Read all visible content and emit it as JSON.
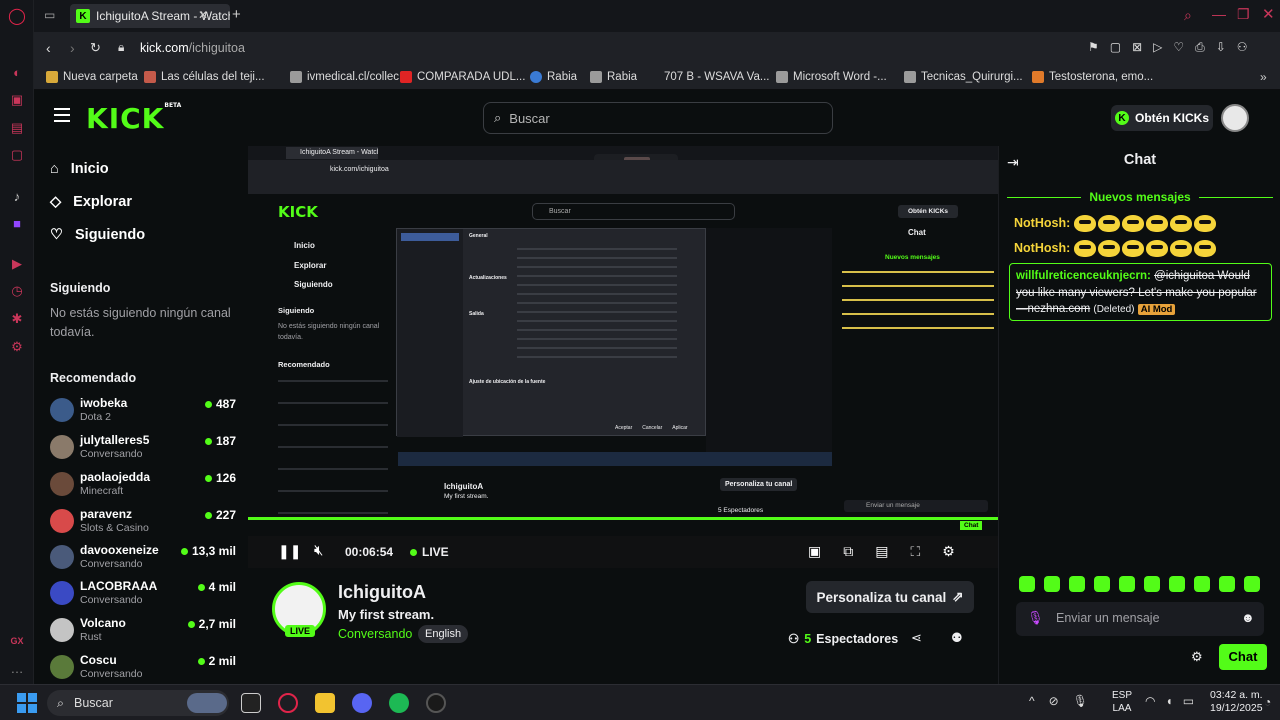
{
  "browser": {
    "tab_title": "IchiguitoA Stream - Watch",
    "new_tab": "+",
    "url_host": "kick.com",
    "url_path": "/ichiguitoa",
    "bookmarks": [
      {
        "label": "Nueva carpeta",
        "color": "#d8a93a"
      },
      {
        "label": "Las células del teji...",
        "color": "#c45a4a"
      },
      {
        "label": "ivmedical.cl/collec...",
        "color": "#9b9b9b"
      },
      {
        "label": "COMPARADA UDL...",
        "color": "#e02424"
      },
      {
        "label": "Rabia",
        "color": "#3a7bd5"
      },
      {
        "label": "Rabia",
        "color": "#9b9b9b"
      },
      {
        "label": "707 B - WSAVA Va...",
        "color": "#1c1e22"
      },
      {
        "label": "Microsoft Word -...",
        "color": "#9b9b9b"
      },
      {
        "label": "Tecnicas_Quirurgi...",
        "color": "#9b9b9b"
      },
      {
        "label": "Testosterona, emo...",
        "color": "#e07a2a"
      }
    ]
  },
  "header": {
    "logo": "KICK",
    "logo_sup": "BETA",
    "search_placeholder": "Buscar",
    "kicks_button": "Obtén KICKs"
  },
  "sidebar": {
    "nav": [
      {
        "label": "Inicio",
        "icon": "home-icon"
      },
      {
        "label": "Explorar",
        "icon": "compass-icon"
      },
      {
        "label": "Siguiendo",
        "icon": "heart-icon"
      }
    ],
    "following_title": "Siguiendo",
    "following_empty": "No estás siguiendo ningún canal todavía.",
    "recommended_title": "Recomendado",
    "recommended": [
      {
        "name": "iwobeka",
        "category": "Dota 2",
        "viewers": "487",
        "color": "#3b5b8a"
      },
      {
        "name": "julytalleres5",
        "category": "Conversando",
        "viewers": "187",
        "color": "#8a7a6a"
      },
      {
        "name": "paolaojedda",
        "category": "Minecraft",
        "viewers": "126",
        "color": "#6a4a3a"
      },
      {
        "name": "paravenz",
        "category": "Slots & Casino",
        "viewers": "227",
        "color": "#d84a4a"
      },
      {
        "name": "davooxeneize",
        "category": "Conversando",
        "viewers": "13,3 mil",
        "color": "#4a5a7a"
      },
      {
        "name": "LACOBRAAA",
        "category": "Conversando",
        "viewers": "4 mil",
        "color": "#3a4ac4"
      },
      {
        "name": "Volcano",
        "category": "Rust",
        "viewers": "2,7 mil",
        "color": "#c4c4c4"
      },
      {
        "name": "Coscu",
        "category": "Conversando",
        "viewers": "2 mil",
        "color": "#5a7a3a"
      }
    ]
  },
  "player": {
    "time": "00:06:54",
    "live": "LIVE",
    "inner": {
      "tab_title": "IchiguitoA Stream - Watch",
      "url": "kick.com/ichiguitoa",
      "search": "Buscar",
      "kicks": "Obtén KICKs",
      "chat_title": "Chat",
      "new_messages": "Nuevos mensajes",
      "customize": "Personaliza tu canal",
      "viewers": "5 Espectadores",
      "send_placeholder": "Enviar un mensaje",
      "chat_button": "Chat",
      "dialog_sections": [
        "General",
        "Actualizaciones",
        "Salida",
        "Ajuste de ubicación de la fuente"
      ],
      "dialog_buttons": [
        "Aceptar",
        "Cancelar",
        "Aplicar"
      ],
      "nav": [
        "Inicio",
        "Explorar",
        "Siguiendo"
      ],
      "following_title": "Siguiendo",
      "following_empty": "No estás siguiendo ningún canal todavía.",
      "recommended_title": "Recomendado",
      "channel_name": "IchiguitoA",
      "stream_title": "My first stream."
    }
  },
  "channel": {
    "name": "IchiguitoA",
    "title": "My first stream.",
    "category": "Conversando",
    "language": "English",
    "live_badge": "LIVE",
    "customize_button": "Personaliza tu canal",
    "viewers_count": "5",
    "viewers_label": "Espectadores"
  },
  "chat": {
    "title": "Chat",
    "new_messages": "Nuevos mensajes",
    "messages": [
      {
        "user": "NotHosh:",
        "type": "emotes",
        "count": 6
      },
      {
        "user": "NotHosh:",
        "type": "emotes",
        "count": 6
      }
    ],
    "deleted": {
      "user": "willfulreticenceuknjecrn:",
      "text": "@ichiguitoa Would you like many viewers? Let's make you popular —nezhna.com",
      "tag": "(Deleted)",
      "badge": "AI Mod"
    },
    "input_placeholder": "Enviar un mensaje",
    "send_button": "Chat"
  },
  "taskbar": {
    "search": "Buscar",
    "lang_line1": "ESP",
    "lang_line2": "LAA",
    "time": "03:42 a. m.",
    "date": "19/12/2025"
  }
}
